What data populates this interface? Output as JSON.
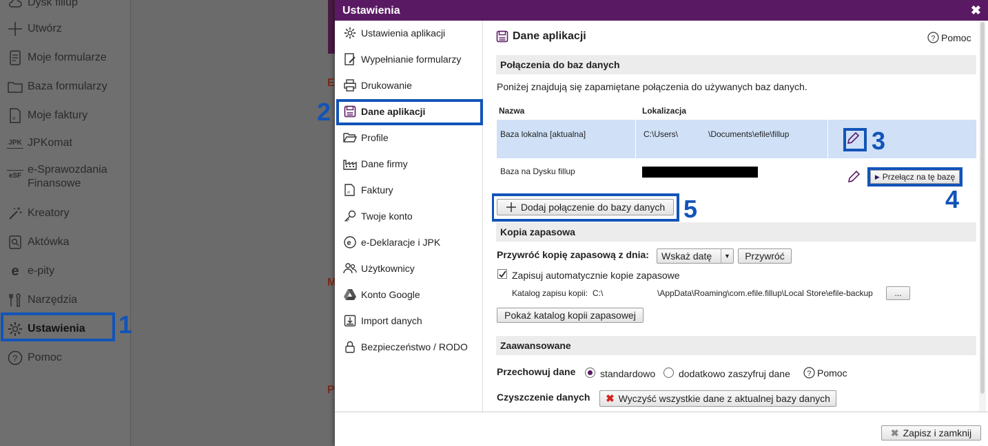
{
  "sidebar": {
    "items": [
      {
        "label": "Dysk fillup",
        "icon": "cloud-icon"
      },
      {
        "label": "Utwórz",
        "icon": "plus-icon"
      },
      {
        "label": "Moje formularze",
        "icon": "document-icon"
      },
      {
        "label": "Baza formularzy",
        "icon": "folder-icon"
      },
      {
        "label": "Moje faktury",
        "icon": "invoice-icon"
      },
      {
        "label": "JPKomat",
        "icon": "jpk-icon",
        "badge": "JPK"
      },
      {
        "label": "e-Sprawozdania",
        "label2": "Finansowe",
        "icon": "esf-icon",
        "badge": "eSF"
      },
      {
        "label": "Kreatory",
        "icon": "wand-icon"
      },
      {
        "label": "Aktówka",
        "icon": "briefcase-icon"
      },
      {
        "label": "e-pity",
        "icon": "epity-icon"
      },
      {
        "label": "Narzędzia",
        "icon": "tools-icon"
      },
      {
        "label": "Ustawienia",
        "icon": "gear-icon"
      },
      {
        "label": "Pomoc",
        "icon": "help-icon"
      }
    ]
  },
  "background": {
    "letters": [
      "E",
      "M",
      "P"
    ]
  },
  "dialog": {
    "title": "Ustawienia",
    "close_symbol": "✖",
    "menu": [
      {
        "label": "Ustawienia aplikacji",
        "icon": "gear-icon"
      },
      {
        "label": "Wypełnianie formularzy",
        "icon": "form-fill-icon"
      },
      {
        "label": "Drukowanie",
        "icon": "printer-icon"
      },
      {
        "label": "Dane aplikacji",
        "icon": "save-icon"
      },
      {
        "label": "Profile",
        "icon": "folder-open-icon"
      },
      {
        "label": "Dane firmy",
        "icon": "factory-icon"
      },
      {
        "label": "Faktury",
        "icon": "invoice-icon"
      },
      {
        "label": "Twoje konto",
        "icon": "key-icon"
      },
      {
        "label": "e-Deklaracje i JPK",
        "icon": "edeklaracje-icon"
      },
      {
        "label": "Użytkownicy",
        "icon": "users-icon"
      },
      {
        "label": "Konto Google",
        "icon": "google-drive-icon"
      },
      {
        "label": "Import danych",
        "icon": "import-icon"
      },
      {
        "label": "Bezpieczeństwo / RODO",
        "icon": "lock-icon"
      }
    ],
    "content": {
      "title": "Dane aplikacji",
      "help": "Pomoc",
      "db_section": "Połączenia do baz danych",
      "db_desc": "Poniżej znajdują się zapamiętane połączenia do używanych baz danych.",
      "table_headers": {
        "name": "Nazwa",
        "location": "Lokalizacja"
      },
      "rows": [
        {
          "name": "Baza lokalna [aktualna]",
          "location_start": "C:\\Users\\",
          "location_end": "\\Documents\\efile\\fillup",
          "selected": true
        },
        {
          "name": "Baza na Dysku fillup",
          "location_redacted": true,
          "switch_label": "Przełącz na tę bazę"
        }
      ],
      "add_connection": "Dodaj połączenie do bazy danych",
      "backup_section": "Kopia zapasowa",
      "restore_label": "Przywróć kopię zapasową z dnia:",
      "date_select": "Wskaż datę",
      "restore_button": "Przywróć",
      "auto_backup_label": "Zapisuj automatycznie kopie zapasowe",
      "auto_backup_checked": true,
      "backup_dir_label": "Katalog zapisu kopii:",
      "backup_dir_start": "C:\\",
      "backup_dir_end": "\\AppData\\Roaming\\com.efile.fillup\\Local Store\\efile-backup",
      "browse_button": "...",
      "show_backup_dir": "Pokaż katalog kopii zapasowej",
      "advanced_section": "Zaawansowane",
      "store_label": "Przechowuj dane",
      "store_options": [
        "standardowo",
        "dodatkowo zaszyfruj dane"
      ],
      "store_selected": "standardowo",
      "store_help": "Pomoc",
      "clear_label": "Czyszczenie danych",
      "clear_button": "Wyczyść wszystkie dane z aktualnej bazy danych"
    },
    "footer": {
      "save_close": "Zapisz i zamknij"
    }
  },
  "annotations": [
    "1",
    "2",
    "3",
    "4",
    "5"
  ],
  "colors": {
    "accent": "#5a1a63",
    "highlight": "#1254b8",
    "selected_row": "#cfe0f7"
  }
}
